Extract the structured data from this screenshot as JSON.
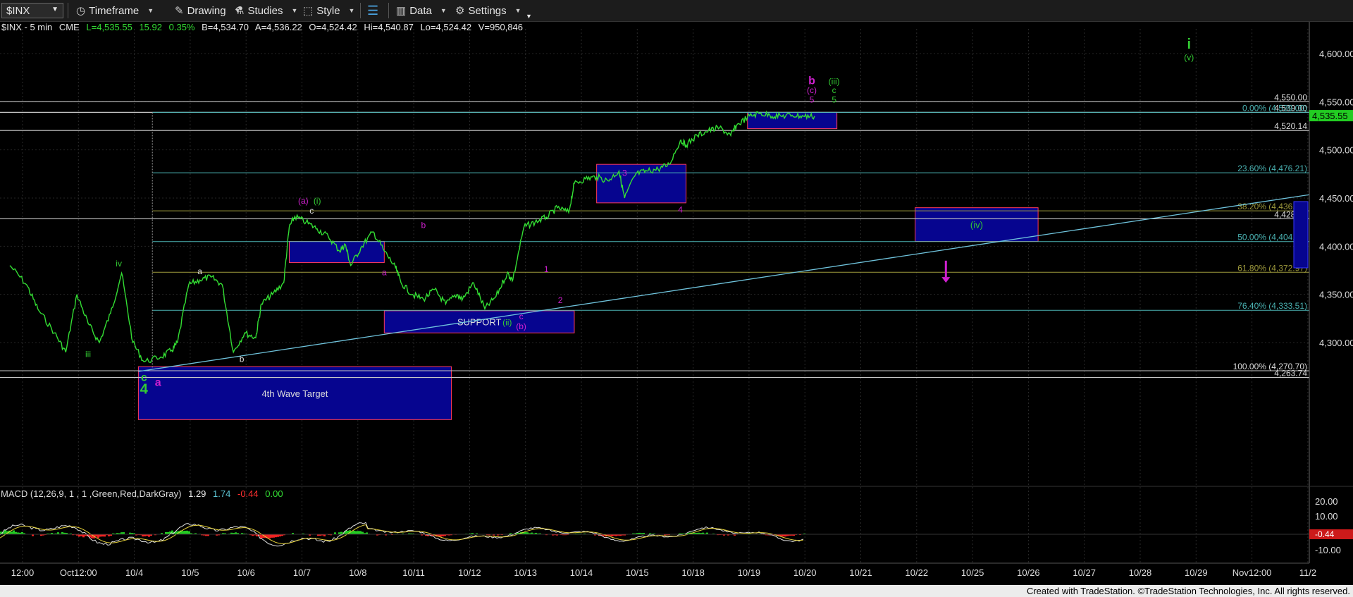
{
  "toolbar": {
    "symbol": "$INX",
    "items": [
      {
        "label": "Timeframe",
        "icon": "clock-icon"
      },
      {
        "label": "Drawing",
        "icon": "pencil-icon"
      },
      {
        "label": "Studies",
        "icon": "studies-icon"
      },
      {
        "label": "Style",
        "icon": "style-icon"
      },
      {
        "label": "",
        "icon": "layout-icon"
      },
      {
        "label": "Data",
        "icon": "data-icon"
      },
      {
        "label": "Settings",
        "icon": "gear-icon"
      }
    ]
  },
  "header": {
    "symbol": "$INX - 5 min",
    "exchange": "CME",
    "last": "L=4,535.55",
    "change": "15.92",
    "pct": "0.35%",
    "bid": "B=4,534.70",
    "ask": "A=4,536.22",
    "open": "O=4,524.42",
    "high": "Hi=4,540.87",
    "low": "Lo=4,524.42",
    "volume": "V=950,846"
  },
  "macd": {
    "label": "MACD (12,26,9, 1 , 1 ,Green,Red,DarkGray)",
    "v1": "1.29",
    "v2": "1.74",
    "v3": "-0.44",
    "v4": "0.00",
    "price_tag": "-0.44",
    "axis": [
      "20.00",
      "10.00",
      "-10.00"
    ]
  },
  "colors": {
    "price": "#33dd33",
    "fib": "#4ab3b3",
    "trendline": "#6fc3dc",
    "box_fill": "#06058f",
    "box_border": "#ff3b5c",
    "magenta": "#d020d0",
    "green_label": "#33cc33",
    "last_price_tag": "#22cc22"
  },
  "chart_data": {
    "type": "line",
    "title": "$INX - 5 min",
    "x_labels": [
      "12:00",
      "Oct12:00",
      "10/4",
      "10/5",
      "10/6",
      "10/7",
      "10/8",
      "10/11",
      "10/12",
      "10/13",
      "10/14",
      "10/15",
      "10/18",
      "10/19",
      "10/20",
      "10/21",
      "10/22",
      "10/25",
      "10/26",
      "10/27",
      "10/28",
      "10/29",
      "Nov12:00",
      "11/2"
    ],
    "y_ticks": [
      "4,600.00",
      "4,550.00",
      "4,500.00",
      "4,450.00",
      "4,400.00",
      "4,350.00",
      "4,300.00"
    ],
    "ylim": [
      4250,
      4650
    ],
    "last_price": "4,535.55",
    "price_series": {
      "x": [
        0,
        0.3,
        0.5,
        0.8,
        1.0,
        1.2,
        1.4,
        1.6,
        1.8,
        2.0,
        2.2,
        2.4,
        2.7,
        2.9,
        3.0,
        3.2,
        3.4,
        3.6,
        3.8,
        4.0,
        4.2,
        4.4,
        4.5,
        4.7,
        4.9,
        5.0,
        5.1,
        5.3,
        5.5,
        5.7,
        5.9,
        6.0,
        6.1,
        6.3,
        6.5,
        6.7,
        6.9,
        7.0,
        7.2,
        7.4,
        7.6,
        7.8,
        8.0,
        8.1,
        8.3,
        8.5,
        8.7,
        8.9,
        9.0,
        9.2,
        9.4,
        9.6,
        9.8,
        10.0,
        10.1,
        10.3,
        10.5,
        10.7,
        10.9,
        11.0,
        11.2,
        11.4,
        11.6,
        11.8,
        12.0,
        12.1,
        12.3,
        12.5,
        12.7,
        12.9,
        13.0,
        13.2,
        13.4,
        13.6,
        13.8,
        14.0,
        14.2,
        14.4
      ],
      "y": [
        4380,
        4360,
        4335,
        4310,
        4290,
        4350,
        4320,
        4300,
        4330,
        4372,
        4300,
        4280,
        4285,
        4292,
        4300,
        4360,
        4365,
        4368,
        4360,
        4290,
        4310,
        4305,
        4340,
        4350,
        4362,
        4420,
        4431,
        4425,
        4418,
        4410,
        4395,
        4402,
        4380,
        4400,
        4415,
        4395,
        4378,
        4362,
        4350,
        4345,
        4355,
        4340,
        4350,
        4345,
        4362,
        4335,
        4348,
        4372,
        4365,
        4420,
        4425,
        4430,
        4440,
        4435,
        4465,
        4470,
        4472,
        4468,
        4478,
        4450,
        4475,
        4478,
        4480,
        4485,
        4510,
        4505,
        4515,
        4520,
        4523,
        4515,
        4525,
        4534,
        4538,
        4536,
        4535,
        4536,
        4535,
        4535
      ]
    },
    "levels": [
      {
        "label": "4,550.00",
        "value": 4550.0
      },
      {
        "label": "4,539.00",
        "value": 4539.0
      },
      {
        "label": "4,520.14",
        "value": 4520.14
      },
      {
        "label": "4,428.47",
        "value": 4428.47
      },
      {
        "label": "4,263.74",
        "value": 4263.74
      }
    ],
    "fib_levels": [
      {
        "label": "0.00% (4,539.00)",
        "value": 4539.0
      },
      {
        "label": "23.60% (4,476.21)",
        "value": 4476.21
      },
      {
        "label": "38.20% (4,436.75)",
        "value": 4436.75
      },
      {
        "label": "50.00% (4,404.86)",
        "value": 4404.86
      },
      {
        "label": "61.80% (4,372.97)",
        "value": 4372.97
      },
      {
        "label": "76.40% (4,333.51)",
        "value": 4333.51
      },
      {
        "label": "100.00% (4,270.70)",
        "value": 4270.7
      }
    ],
    "boxes": [
      {
        "x1": 2.3,
        "x2": 7.9,
        "y1": 4275,
        "y2": 4220,
        "label": "4th Wave Target"
      },
      {
        "x1": 6.7,
        "x2": 10.1,
        "y1": 4333,
        "y2": 4310,
        "label": "SUPPORT"
      },
      {
        "x1": 5.0,
        "x2": 6.7,
        "y1": 4405,
        "y2": 4383,
        "label": ""
      },
      {
        "x1": 10.5,
        "x2": 12.1,
        "y1": 4485,
        "y2": 4445,
        "label": ""
      },
      {
        "x1": 13.2,
        "x2": 14.8,
        "y1": 4539,
        "y2": 4522,
        "label": ""
      },
      {
        "x1": 16.2,
        "x2": 18.4,
        "y1": 4440,
        "y2": 4405,
        "label": "(iv)"
      }
    ],
    "trendline": {
      "x": [
        2.3,
        24.0
      ],
      "y": [
        4270,
        4460
      ]
    },
    "wave_labels": [
      {
        "text": "i",
        "x": 21.1,
        "y": 4605,
        "color": "green",
        "size": "lg"
      },
      {
        "text": "(v)",
        "x": 21.1,
        "y": 4593,
        "color": "green",
        "size": "sm"
      },
      {
        "text": "b",
        "x": 14.35,
        "y": 4568,
        "color": "magenta",
        "size": "md"
      },
      {
        "text": "(iii)",
        "x": 14.75,
        "y": 4568,
        "color": "green",
        "size": "sm"
      },
      {
        "text": "(c)",
        "x": 14.35,
        "y": 4559,
        "color": "magenta",
        "size": "sm"
      },
      {
        "text": "c",
        "x": 14.75,
        "y": 4559,
        "color": "green",
        "size": "sm"
      },
      {
        "text": "5",
        "x": 14.35,
        "y": 4549,
        "color": "magenta",
        "size": "sm"
      },
      {
        "text": "5",
        "x": 14.75,
        "y": 4549,
        "color": "green",
        "size": "sm"
      },
      {
        "text": "(a)",
        "x": 5.25,
        "y": 4444,
        "color": "magenta",
        "size": "sm"
      },
      {
        "text": "(i)",
        "x": 5.5,
        "y": 4444,
        "color": "green",
        "size": "sm"
      },
      {
        "text": "c",
        "x": 5.4,
        "y": 4434,
        "color": "white",
        "size": "sm"
      },
      {
        "text": "b",
        "x": 7.4,
        "y": 4419,
        "color": "magenta",
        "size": "sm"
      },
      {
        "text": "a",
        "x": 6.7,
        "y": 4370,
        "color": "magenta",
        "size": "sm"
      },
      {
        "text": "1",
        "x": 9.6,
        "y": 4373,
        "color": "magenta",
        "size": "sm"
      },
      {
        "text": "2",
        "x": 9.85,
        "y": 4341,
        "color": "magenta",
        "size": "sm"
      },
      {
        "text": "3",
        "x": 11.0,
        "y": 4473,
        "color": "magenta",
        "size": "sm"
      },
      {
        "text": "4",
        "x": 12.0,
        "y": 4435,
        "color": "magenta",
        "size": "sm"
      },
      {
        "text": "c",
        "x": 9.15,
        "y": 4324,
        "color": "magenta",
        "size": "sm"
      },
      {
        "text": "(b)",
        "x": 9.15,
        "y": 4314,
        "color": "magenta",
        "size": "sm"
      },
      {
        "text": "(ii)",
        "x": 8.9,
        "y": 4318,
        "color": "green",
        "size": "sm"
      },
      {
        "text": "iv",
        "x": 1.95,
        "y": 4379,
        "color": "green",
        "size": "sm"
      },
      {
        "text": "iii",
        "x": 1.4,
        "y": 4285,
        "color": "green",
        "size": "sm"
      },
      {
        "text": "a",
        "x": 3.4,
        "y": 4371,
        "color": "white",
        "size": "sm"
      },
      {
        "text": "b",
        "x": 4.15,
        "y": 4280,
        "color": "white",
        "size": "sm"
      },
      {
        "text": "c",
        "x": 2.4,
        "y": 4260,
        "color": "green",
        "size": "md"
      },
      {
        "text": "4",
        "x": 2.4,
        "y": 4247,
        "color": "green",
        "size": "lg"
      },
      {
        "text": "a",
        "x": 2.65,
        "y": 4255,
        "color": "magenta",
        "size": "md"
      }
    ],
    "annotations": [
      {
        "type": "arrow-down",
        "x": 16.75,
        "y1": 4385,
        "y2": 4368
      }
    ]
  },
  "footer": {
    "credit": "Created with TradeStation. ©TradeStation Technologies, Inc. All rights reserved."
  }
}
